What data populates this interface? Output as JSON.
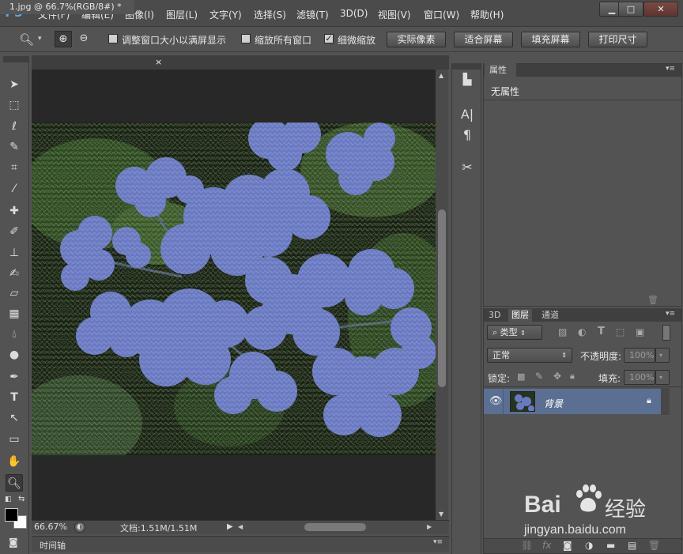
{
  "app": {
    "logo": "Ps"
  },
  "menu": [
    "文件(F)",
    "编辑(E)",
    "图像(I)",
    "图层(L)",
    "文字(Y)",
    "选择(S)",
    "滤镜(T)",
    "3D(D)",
    "视图(V)",
    "窗口(W)",
    "帮助(H)"
  ],
  "window_buttons": {
    "minimize": "▁",
    "maximize": "□",
    "close": "✕"
  },
  "options": {
    "resize_windows": {
      "label": "调整窗口大小以满屏显示",
      "checked": false
    },
    "zoom_all": {
      "label": "缩放所有窗口",
      "checked": false
    },
    "scrubby": {
      "label": "细微缩放",
      "checked": true
    },
    "buttons": [
      "实际像素",
      "适合屏幕",
      "填充屏幕",
      "打印尺寸"
    ]
  },
  "document": {
    "tab_title": "1.jpg @ 66.7%(RGB/8#) *",
    "close": "×",
    "zoom": "66.67%",
    "doc_info": "文档:1.51M/1.51M"
  },
  "timeline": {
    "label": "时间轴"
  },
  "properties": {
    "tab": "属性",
    "content": "无属性"
  },
  "layers": {
    "tabs": [
      "3D",
      "图层",
      "通道"
    ],
    "filter_kind": "类型",
    "blend_mode": "正常",
    "opacity_label": "不透明度:",
    "opacity_value": "100%",
    "lock_label": "锁定:",
    "fill_label": "填充:",
    "fill_value": "100%",
    "items": [
      {
        "name": "背景",
        "locked": true,
        "visible": true
      }
    ]
  },
  "watermark": {
    "brand": "Bai",
    "brand2": "经验",
    "url": "jingyan.baidu.com"
  },
  "colors": {
    "accent": "#58a8e8",
    "selected_layer": "#5b6f93",
    "canvas_bg": "#282828",
    "panel_bg": "#535353"
  }
}
